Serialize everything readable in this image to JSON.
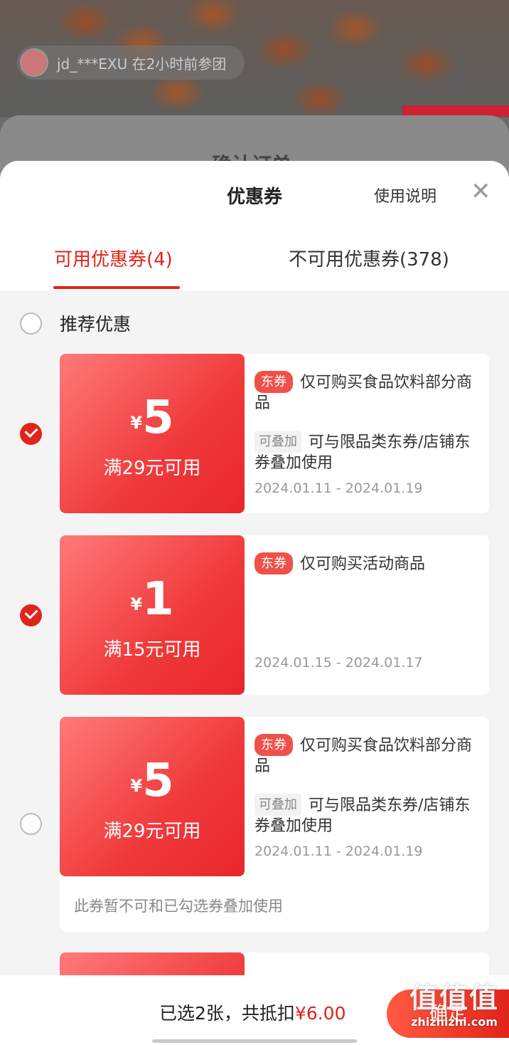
{
  "background": {
    "user_text": "jd_***EXU  在2小时前参团",
    "sheet_title": "确认订单"
  },
  "sheet": {
    "title": "优惠券",
    "help_label": "使用说明",
    "close_glyph": "✕"
  },
  "tabs": [
    {
      "label": "可用优惠券(4)",
      "active": true
    },
    {
      "label": "不可用优惠券(378)",
      "active": false
    }
  ],
  "recommend": {
    "label": "推荐优惠"
  },
  "coupons": [
    {
      "currency": "¥",
      "amount": "5",
      "threshold": "满29元可用",
      "tag": "东券",
      "description": "仅可购买食品饮料部分商品",
      "stack_tag": "可叠加",
      "stack_desc": "可与限品类东券/店铺东券叠加使用",
      "date": "2024.01.11 - 2024.01.19",
      "checked": true
    },
    {
      "currency": "¥",
      "amount": "1",
      "threshold": "满15元可用",
      "tag": "东券",
      "description": "仅可购买活动商品",
      "date": "2024.01.15 - 2024.01.17",
      "checked": true
    },
    {
      "currency": "¥",
      "amount": "5",
      "threshold": "满29元可用",
      "tag": "东券",
      "description": "仅可购买食品饮料部分商品",
      "stack_tag": "可叠加",
      "stack_desc": "可与限品类东券/店铺东券叠加使用",
      "date": "2024.01.11 - 2024.01.19",
      "note": "此券暂不可和已勾选券叠加使用",
      "checked": false
    }
  ],
  "footer": {
    "summary_prefix": "已选2张，共抵扣",
    "summary_amount": "¥6.00",
    "confirm_label": "确定"
  },
  "watermark": {
    "line1": "值值值",
    "line2": "zhizhizhi.com"
  },
  "colors": {
    "accent": "#e2231a",
    "coupon_gradient_start": "#ff7a7a",
    "coupon_gradient_end": "#e8262b"
  }
}
